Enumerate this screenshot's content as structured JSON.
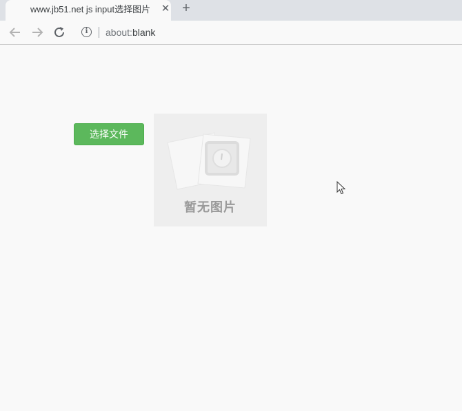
{
  "browser": {
    "tab": {
      "title": "www.jb51.net js input选择图片",
      "close_icon": "close-icon"
    },
    "new_tab_icon": "plus-icon",
    "toolbar": {
      "back_icon": "arrow-left-icon",
      "forward_icon": "arrow-right-icon",
      "reload_icon": "reload-icon",
      "info_icon": "info-icon",
      "url_scheme": "about:",
      "url_path": "blank"
    }
  },
  "page": {
    "choose_file_label": "选择文件",
    "choose_file_color": "#5cb85c",
    "preview": {
      "placeholder_text": "暂无图片",
      "background": "#eeeeee"
    }
  }
}
